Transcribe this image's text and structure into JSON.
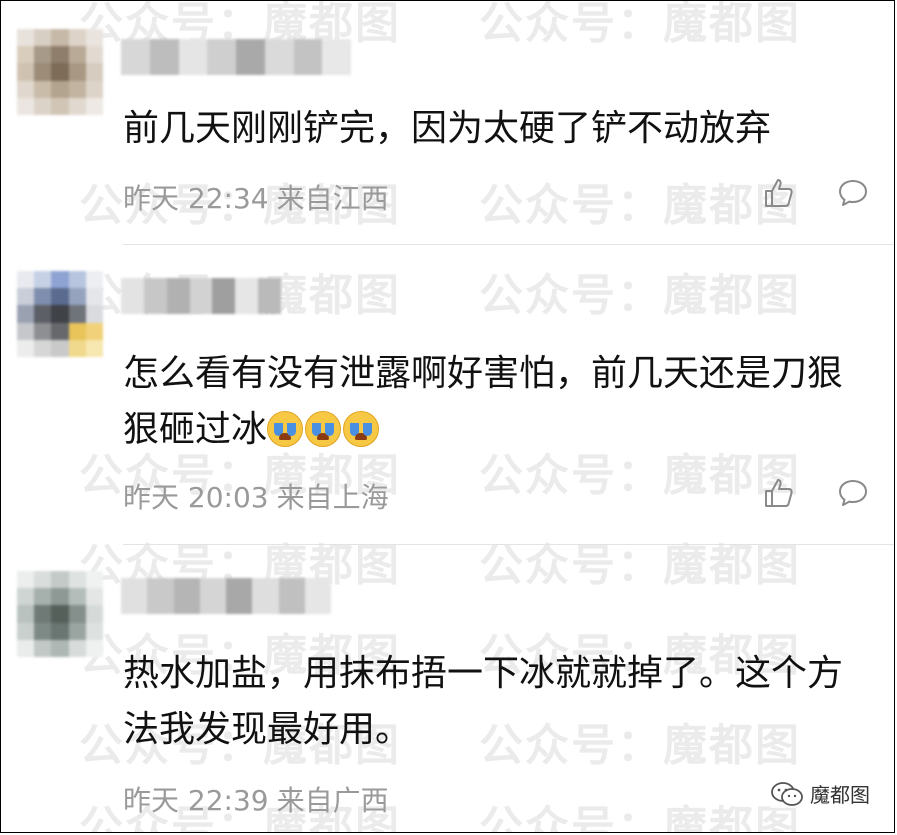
{
  "watermark": {
    "text": "公众号：魔都图"
  },
  "comments": [
    {
      "text": "前几天刚刚铲完，因为太硬了铲不动放弃",
      "time": "昨天 22:34",
      "location": "来自江西",
      "avatar_colors": [
        "#e8e2dc",
        "#d8cfc4",
        "#c7b9a8",
        "#ddd3c8",
        "#eae4de",
        "#d9cdbd",
        "#a89a88",
        "#8f7e6c",
        "#b9aa97",
        "#e2dad1",
        "#cfc2b1",
        "#9c8c78",
        "#7e6c59",
        "#a99883",
        "#d7ccc0",
        "#e0d8ce",
        "#c9bca9",
        "#b3a48f",
        "#c2b4a1",
        "#ddd4c9",
        "#ebe6e1",
        "#dcd3c8",
        "#d1c5b6",
        "#e1d9cf",
        "#eee9e4"
      ],
      "username_blocks": [
        "#d7d7d7",
        "#bdbdbd",
        "#e5e5e5",
        "#cfcfcf",
        "#a9a9a9",
        "#dadada",
        "#c3c3c3",
        "#e8e8e8"
      ]
    },
    {
      "text": "怎么看有没有泄露啊好害怕，前几天还是刀狠狠砸过冰",
      "emoji_icons": [
        "loudly-crying-face-icon",
        "loudly-crying-face-icon",
        "loudly-crying-face-icon"
      ],
      "time": "昨天 20:03",
      "location": "来自上海",
      "avatar_colors": [
        "#e8eaf0",
        "#c7d1e6",
        "#8ea3d2",
        "#b8c5df",
        "#eceef2",
        "#c9ced9",
        "#7f8eae",
        "#5a6b8f",
        "#95a3bf",
        "#e4e6ea",
        "#9aa2b2",
        "#5c5f66",
        "#3f4247",
        "#6f737a",
        "#d9dbdf",
        "#c5c7cb",
        "#8d8f93",
        "#66686c",
        "#e8c45a",
        "#f1d27a",
        "#ececec",
        "#d6d6d6",
        "#c9c9c9",
        "#f0d98c",
        "#f7e7b0"
      ],
      "username_blocks": [
        "#e3e3e3",
        "#c7c7c7",
        "#b1b1b1",
        "#d2d2d2",
        "#9f9f9f",
        "#e6e6e6",
        "#bababa"
      ]
    },
    {
      "text": "热水加盐，用抹布捂一下冰就就掉了。这个方法我发现最好用。",
      "time": "昨天 22:39",
      "location": "来自广西",
      "avatar_colors": [
        "#eceeee",
        "#d9dddc",
        "#c4cac8",
        "#dee2e1",
        "#f0f1f1",
        "#cfd5d3",
        "#a6b0ac",
        "#8e9995",
        "#b4bdba",
        "#e3e6e5",
        "#b9c2be",
        "#6f7a76",
        "#55605b",
        "#85908c",
        "#d5dad8",
        "#c9d0cd",
        "#7e8a85",
        "#6a7671",
        "#9aa5a1",
        "#dde1df",
        "#e9ecea",
        "#c1c8c5",
        "#aeb7b3",
        "#d7dcda",
        "#eff1f0"
      ],
      "username_blocks": [
        "#e0e0e0",
        "#c9c9c9",
        "#b5b5b5",
        "#d5d5d5",
        "#a8a8a8",
        "#dedede",
        "#c0c0c0",
        "#e6e6e6"
      ]
    }
  ],
  "signature": {
    "label": "魔都图"
  },
  "colors": {
    "text": "#111111",
    "meta": "#9a9a9a",
    "divider": "#e3e3e3",
    "icon": "#8a8a8a"
  }
}
